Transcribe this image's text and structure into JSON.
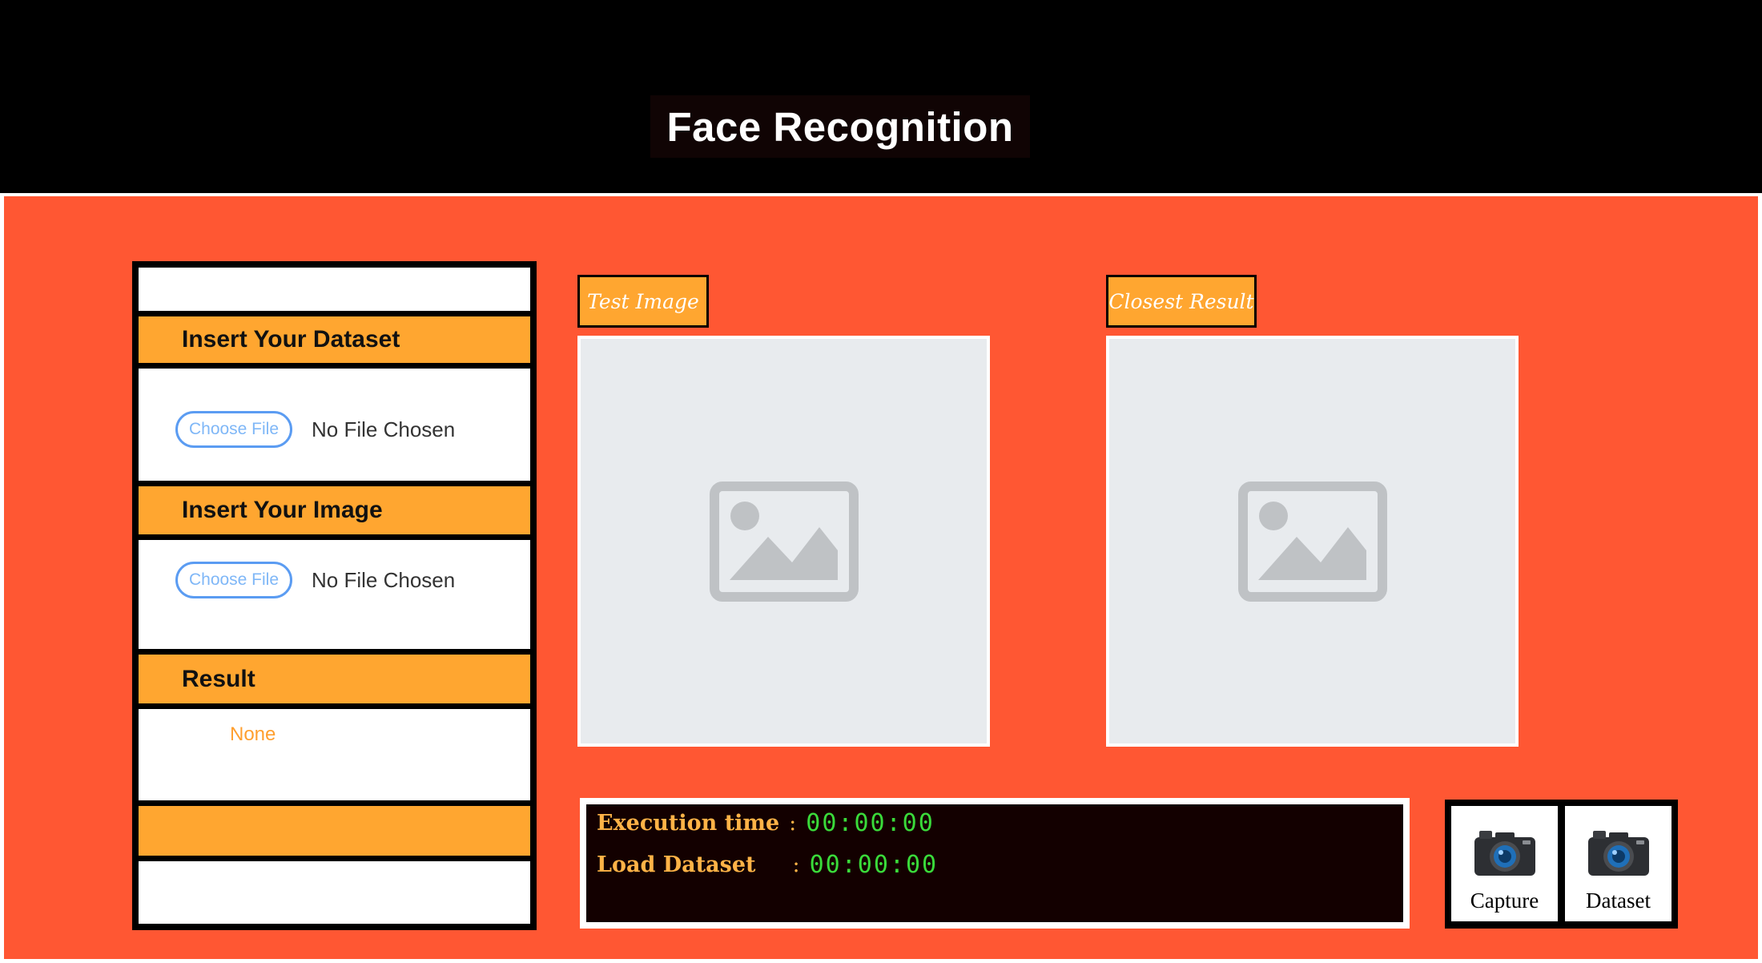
{
  "header": {
    "title": "Face Recognition"
  },
  "sidebar": {
    "dataset_section": {
      "title": "Insert Your Dataset",
      "button_label": "Choose File",
      "file_status": "No File Chosen"
    },
    "image_section": {
      "title": "Insert Your Image",
      "button_label": "Choose File",
      "file_status": "No File Chosen"
    },
    "result_section": {
      "title": "Result",
      "value": "None"
    }
  },
  "test_image": {
    "label": "Test Image",
    "placeholder_icon": "image-placeholder-icon"
  },
  "closest_result": {
    "label": "Closest Result",
    "placeholder_icon": "image-placeholder-icon"
  },
  "timing": {
    "execution_label": "Execution time",
    "execution_value": "00:00:00",
    "load_label": "Load Dataset",
    "load_value": "00:00:00",
    "separator": ":"
  },
  "actions": {
    "capture": {
      "label": "Capture",
      "icon": "camera-icon"
    },
    "dataset": {
      "label": "Dataset",
      "icon": "camera-icon"
    }
  },
  "colors": {
    "background": "#ff5733",
    "accent": "#ffa630",
    "header": "#000000",
    "console_bg": "#130000",
    "console_time": "#3adb3a",
    "console_label": "#ffb347"
  }
}
